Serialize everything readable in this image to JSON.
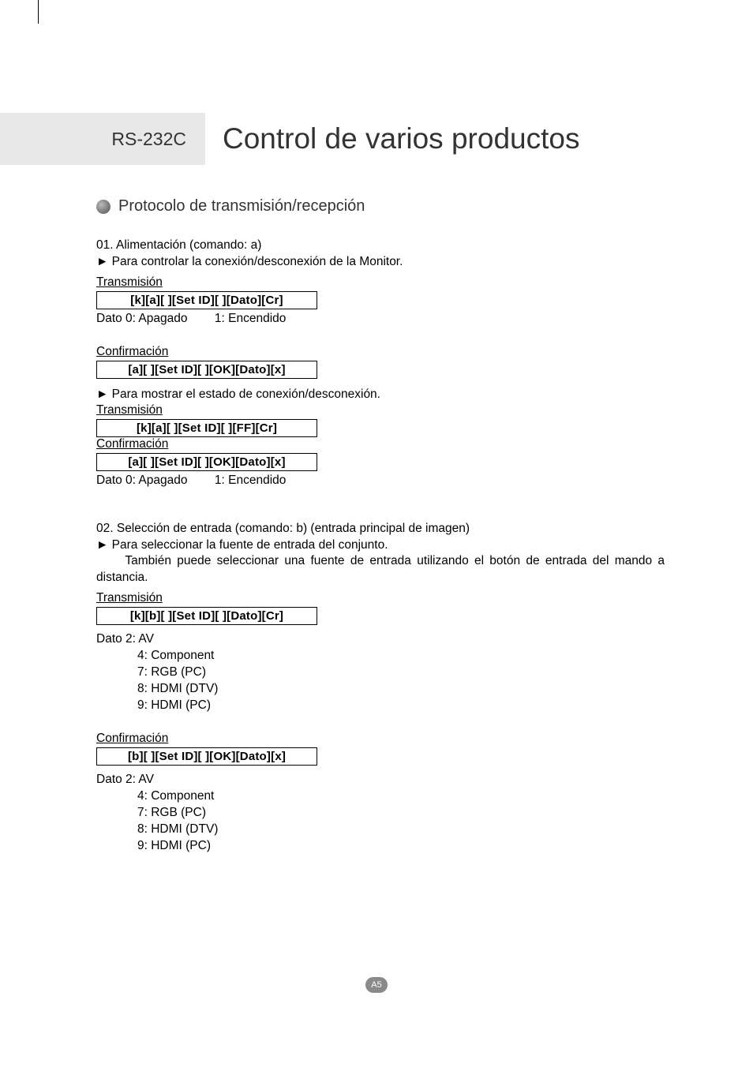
{
  "header": {
    "left": "RS-232C",
    "right": "Control de varios productos"
  },
  "section_title": "Protocolo de transmisión/recepción",
  "cmd01": {
    "title": "01. Alimentación (comando: a)",
    "desc": "► Para controlar la conexión/desconexión de la Monitor.",
    "tx_label": "Transmisión",
    "tx_code": "[k][a][ ][Set ID][ ][Dato][Cr]",
    "tx_data": "Dato 0: Apagado        1: Encendido",
    "conf_label": "Confirmación",
    "conf_code": "[a][ ][Set ID][ ][OK][Dato][x]",
    "desc2": "► Para mostrar el estado de conexión/desconexión.",
    "tx2_label": "Transmisión",
    "tx2_code": "[k][a][ ][Set ID][ ][FF][Cr]",
    "conf2_label": "Confirmación",
    "conf2_code": "[a][ ][Set ID][ ][OK][Dato][x]",
    "data2": "Dato 0: Apagado        1: Encendido"
  },
  "cmd02": {
    "title": "02. Selección de entrada (comando: b) (entrada principal de imagen)",
    "desc_l1": "► Para seleccionar la fuente de entrada del conjunto.",
    "desc_l2": "     También puede seleccionar una fuente de entrada utilizando el botón de entrada del mando a distancia.",
    "tx_label": "Transmisión",
    "tx_code": "[k][b][ ][Set ID][ ][Dato][Cr]",
    "data_head": "Dato 2: AV",
    "data_l2": "4: Component",
    "data_l3": "7: RGB (PC)",
    "data_l4": "8: HDMI (DTV)",
    "data_l5": "9: HDMI (PC)",
    "conf_label": "Confirmación",
    "conf_code": "[b][ ][Set ID][ ][OK][Dato][x]",
    "data2_head": "Dato 2: AV",
    "data2_l2": "4: Component",
    "data2_l3": "7: RGB (PC)",
    "data2_l4": "8: HDMI (DTV)",
    "data2_l5": "9: HDMI (PC)"
  },
  "page_number": "A5"
}
